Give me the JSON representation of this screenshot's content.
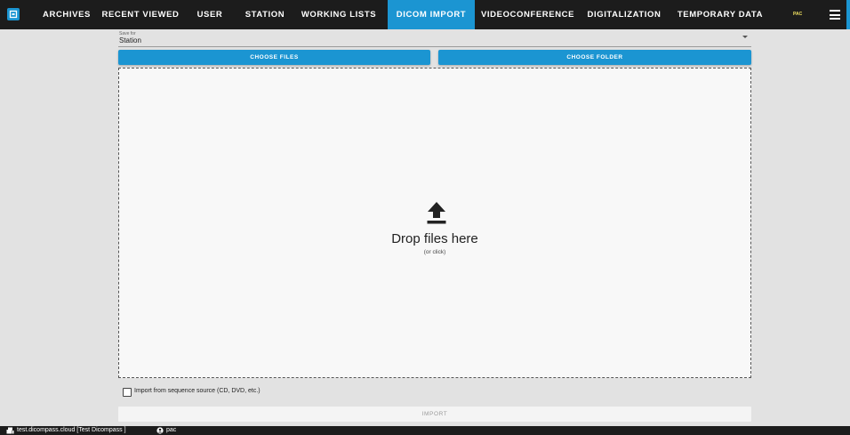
{
  "nav": {
    "tabs": [
      {
        "label": "ARCHIVES"
      },
      {
        "label": "RECENT VIEWED"
      },
      {
        "label": "USER"
      },
      {
        "label": "STATION"
      },
      {
        "label": "WORKING LISTS"
      },
      {
        "label": "DICOM IMPORT",
        "active": true
      },
      {
        "label": "VIDEOCONFERENCE"
      },
      {
        "label": "DIGITALIZATION"
      },
      {
        "label": "TEMPORARY DATA"
      }
    ],
    "user_badge": "PAC"
  },
  "form": {
    "save_for_label": "Save for",
    "save_for_value": "Station",
    "choose_files": "CHOOSE FILES",
    "choose_folder": "CHOOSE FOLDER",
    "drop_title": "Drop files here",
    "drop_sub": "(or click)",
    "checkbox_label": "Import from sequence source (CD, DVD, etc.)",
    "import_label": "IMPORT"
  },
  "status": {
    "server": "test.dicompass.cloud [Test Dicompass ]",
    "user": "pac"
  },
  "colors": {
    "accent": "#1b95d2",
    "topbar": "#1c1c1c",
    "background": "#e2e2e2"
  }
}
